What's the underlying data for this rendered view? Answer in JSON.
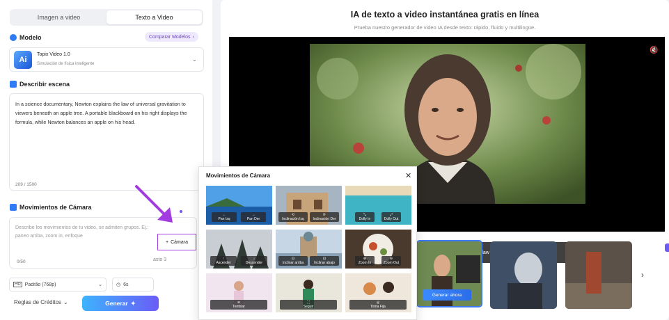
{
  "tabs": [
    "Imagen a video",
    "Texto a Video"
  ],
  "model": {
    "section": "Modelo",
    "compare": "Comparar Modelos",
    "name": "Topix Video 1.0",
    "sub": "Simulación de física inteligente",
    "logo": "Ai"
  },
  "scene": {
    "section": "Describir escena",
    "text": "In a science documentary, Newton explains the law of universal gravitation to viewers beneath an apple tree. A portable blackboard on his right displays the formula, while Newton balances an apple on his head.",
    "counter": "209 / 1500"
  },
  "camera": {
    "section": "Movimientos de Cámara",
    "placeholder": "Describe los movimientos de tu video, se admiten grupos. Ej.: paneo arriba, zoom in, enfoque",
    "counter": "0/50",
    "button": "Cámara",
    "resto": "asto 3"
  },
  "settings": {
    "resolution": "Padrão (768p)",
    "duration": "6s"
  },
  "footer": {
    "credits": "Reglas de Créditos",
    "generate": "Generar"
  },
  "main": {
    "title": "IA de texto a video instantánea gratis en línea",
    "subtitle": "Prueba nuestro generador de video IA desde texto: rápido, fluido y multilingüe.",
    "caption": "apple tree explains gravity law with formula and apple gag.",
    "generate_now": "Generar ahora"
  },
  "popup": {
    "title": "Movimientos de Cámara",
    "rows": [
      [
        [
          "Pan Izq",
          "Pan Der"
        ],
        [
          "Inclinación Izq",
          "Inclinación Der"
        ],
        [
          "Dolly In",
          "Dolly Out"
        ]
      ],
      [
        [
          "Ascender",
          "Descender"
        ],
        [
          "Inclinar arriba",
          "Inclinar abajo"
        ],
        [
          "Zoom In",
          "Zoom Out"
        ]
      ],
      [
        [
          "Temblar"
        ],
        [
          "Seguir"
        ],
        [
          "Toma Fija"
        ]
      ]
    ]
  },
  "colors": {
    "accent": "#6b5cf6",
    "purple_arrow": "#a23be0",
    "link": "#6b3fd8"
  }
}
